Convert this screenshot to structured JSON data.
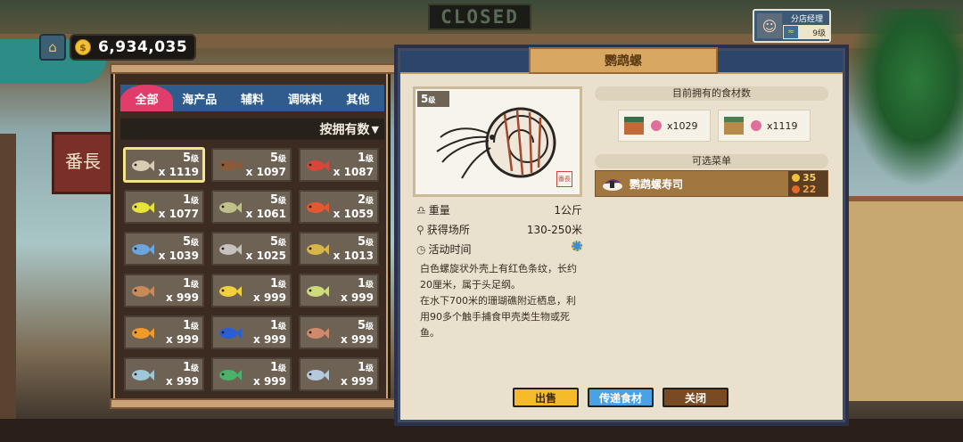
{
  "hud": {
    "home_icon": "home-icon",
    "coin_icon": "coin-icon",
    "coin_symbol": "$",
    "money": "6,934,035",
    "manager_title": "分店经理",
    "manager_level": "9级",
    "background_sign": "CLOSED",
    "kanban_text": "番長"
  },
  "inventory": {
    "tabs": [
      {
        "label": "全部",
        "active": true
      },
      {
        "label": "海产品",
        "active": false
      },
      {
        "label": "辅料",
        "active": false
      },
      {
        "label": "调味料",
        "active": false
      },
      {
        "label": "其他",
        "active": false
      }
    ],
    "sort_label": "按拥有数",
    "level_suffix": "级",
    "items": [
      {
        "level": "5",
        "count": "x 1119",
        "selected": true,
        "icon": "nautilus-icon",
        "color": "#d9cbb4"
      },
      {
        "level": "5",
        "count": "x 1097",
        "icon": "rockfish-icon",
        "color": "#8a5a3a"
      },
      {
        "level": "1",
        "count": "x 1087",
        "icon": "red-fish-icon",
        "color": "#d8463a"
      },
      {
        "level": "1",
        "count": "x 1077",
        "icon": "yellow-fish-icon",
        "color": "#e8e33a"
      },
      {
        "level": "5",
        "count": "x 1061",
        "icon": "seaweed-icon",
        "color": "#c2c08a"
      },
      {
        "level": "2",
        "count": "x 1059",
        "icon": "grouper-icon",
        "color": "#e4582f"
      },
      {
        "level": "5",
        "count": "x 1039",
        "icon": "flying-fish-icon",
        "color": "#6aa6dc"
      },
      {
        "level": "5",
        "count": "x 1025",
        "icon": "squid-icon",
        "color": "#c6c2bd"
      },
      {
        "level": "5",
        "count": "x 1013",
        "icon": "pufferfish-icon",
        "color": "#d8b44a"
      },
      {
        "level": "1",
        "count": "x 999",
        "icon": "small-fish-icon",
        "color": "#c98a5a"
      },
      {
        "level": "1",
        "count": "x 999",
        "icon": "butterflyfish-icon",
        "color": "#f2d03a"
      },
      {
        "level": "1",
        "count": "x 999",
        "icon": "yellowtail-icon",
        "color": "#cddc7a"
      },
      {
        "level": "1",
        "count": "x 999",
        "icon": "goldfish-icon",
        "color": "#f09a2a"
      },
      {
        "level": "1",
        "count": "x 999",
        "icon": "blue-tang-icon",
        "color": "#2a5ed4"
      },
      {
        "level": "5",
        "count": "x 999",
        "icon": "seahorse-icon",
        "color": "#d08a6a"
      },
      {
        "level": "1",
        "count": "x 999",
        "icon": "mackerel-icon",
        "color": "#9ec7d8"
      },
      {
        "level": "1",
        "count": "x 999",
        "icon": "parrotfish-icon",
        "color": "#4ab26a"
      },
      {
        "level": "1",
        "count": "x 999",
        "icon": "angelfish-icon",
        "color": "#b6c8dc"
      }
    ]
  },
  "detail": {
    "title": "鹦鹉螺",
    "level": "5",
    "level_suffix": "级",
    "stamp": "番長",
    "weight_label": "重量",
    "weight_value": "1公斤",
    "location_label": "获得场所",
    "location_value": "130-250米",
    "time_label": "活动时间",
    "description": "白色螺旋状外壳上有红色条纹，长约20厘米，属于头足纲。\n在水下700米的珊瑚礁附近栖息，利用90多个触手捕食甲壳类生物或死鱼。",
    "owned_header": "目前拥有的食材数",
    "owned": [
      {
        "count": "x1029",
        "building_icon": "restaurant-icon",
        "item_icon": "meat-icon"
      },
      {
        "count": "x1119",
        "building_icon": "boat-shop-icon",
        "item_icon": "meat-icon"
      }
    ],
    "menu_header": "可选菜单",
    "menu_item": {
      "name": "鹦鹉螺寿司",
      "gold_price": "35",
      "taste": "22",
      "icon": "sushi-icon"
    },
    "buttons": {
      "sell": "出售",
      "send": "传递食材",
      "close": "关闭"
    }
  }
}
